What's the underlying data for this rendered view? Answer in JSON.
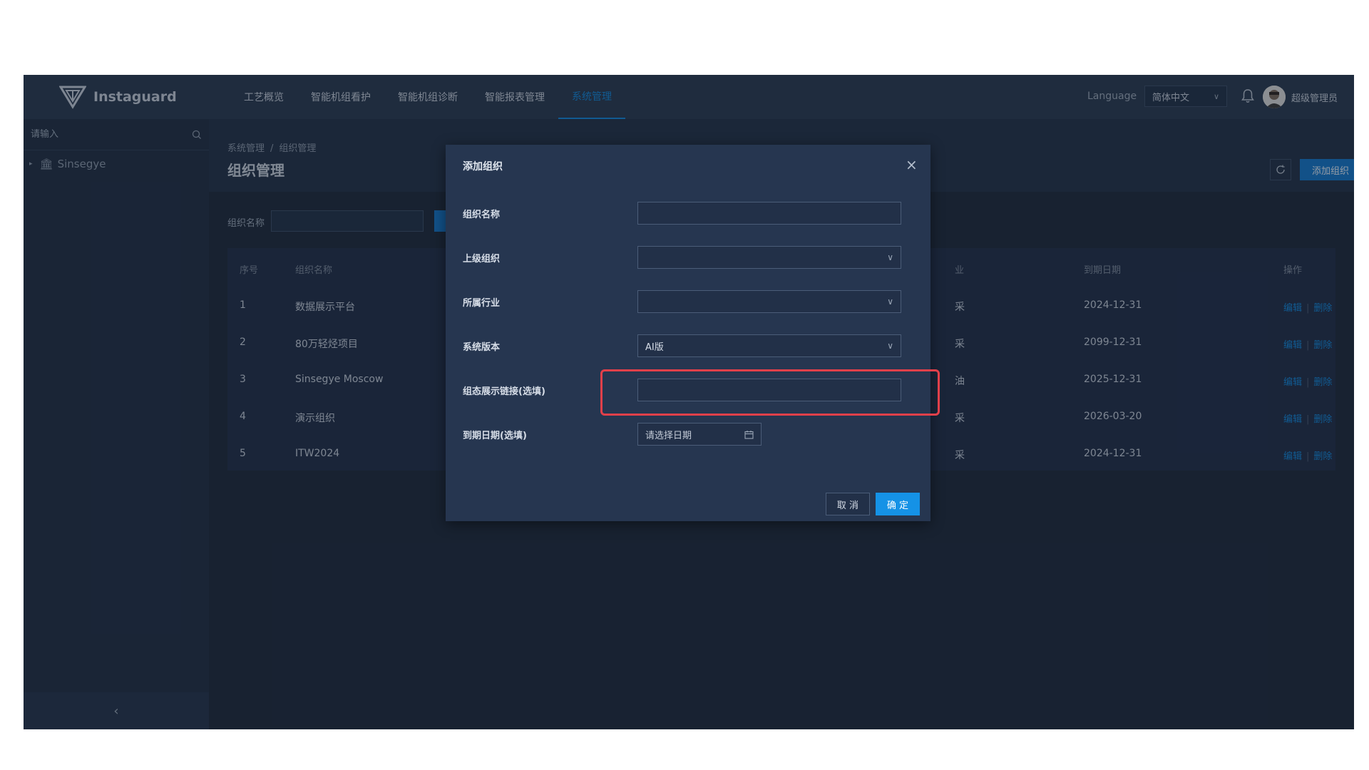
{
  "header": {
    "logo_text": "Instaguard",
    "nav": [
      "工艺概览",
      "智能机组看护",
      "智能机组诊断",
      "智能报表管理",
      "系统管理"
    ],
    "active_nav": "系统管理",
    "language_label": "Language",
    "language_value": "简体中文",
    "user_name": "超级管理员"
  },
  "sidebar": {
    "search_placeholder": "请输入",
    "tree_root": "Sinsegye"
  },
  "page": {
    "breadcrumb": [
      "系统管理",
      "组织管理"
    ],
    "title": "组织管理",
    "add_button": "添加组织",
    "filter_label": "组织名称",
    "columns": [
      "序号",
      "组织名称",
      "业",
      "到期日期",
      "操作"
    ],
    "rows": [
      {
        "index": "1",
        "name": "数据展示平台",
        "industry": "采",
        "expiry": "2024-12-31"
      },
      {
        "index": "2",
        "name": "80万轻烃项目",
        "industry": "采",
        "expiry": "2099-12-31"
      },
      {
        "index": "3",
        "name": "Sinsegye Moscow",
        "industry": "油",
        "expiry": "2025-12-31"
      },
      {
        "index": "4",
        "name": "演示组织",
        "industry": "采",
        "expiry": "2026-03-20"
      },
      {
        "index": "5",
        "name": "ITW2024",
        "industry": "采",
        "expiry": "2024-12-31"
      }
    ],
    "edit_label": "编辑",
    "delete_label": "删除"
  },
  "modal": {
    "title": "添加组织",
    "fields": {
      "org_name": {
        "label": "组织名称",
        "value": ""
      },
      "parent_org": {
        "label": "上级组织",
        "value": ""
      },
      "industry": {
        "label": "所属行业",
        "value": ""
      },
      "version": {
        "label": "系统版本",
        "value": "AI版"
      },
      "display_link": {
        "label": "组态展示链接(选填)",
        "value": ""
      },
      "expiry_date": {
        "label": "到期日期(选填)",
        "placeholder": "请选择日期"
      }
    },
    "cancel_label": "取 消",
    "ok_label": "确 定"
  },
  "colors": {
    "accent": "#1486d9",
    "primary_button": "#1592e6",
    "highlight": "#e2404a",
    "background": "#1f2b3d"
  }
}
